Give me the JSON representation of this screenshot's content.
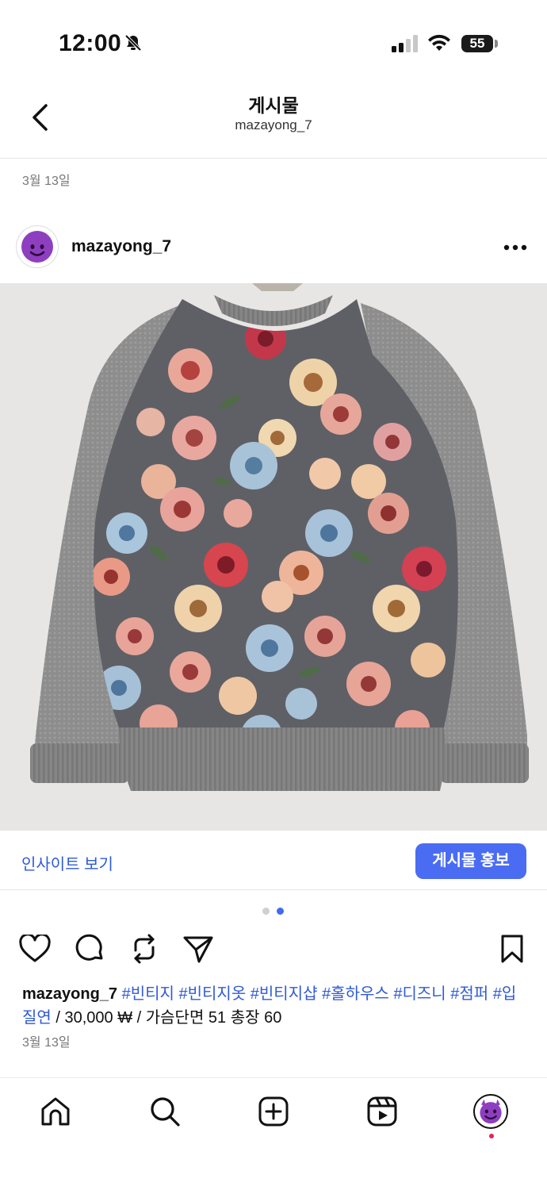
{
  "status_bar": {
    "time": "12:00",
    "battery": "55"
  },
  "header": {
    "title": "게시물",
    "subtitle": "mazayong_7"
  },
  "post": {
    "date_top": "3월 13일",
    "author": "mazayong_7",
    "insight_label": "인사이트 보기",
    "promote_label": "게시물 홍보",
    "caption_user": "mazayong_7",
    "caption_tags_1": "#빈티지 #빈티지옷 #빈티지샵 #홀하우스 #디즈니 #점퍼 #입질연",
    "caption_text": " / 30,000 ₩ / 가슴단면 51 총장 60",
    "date_bottom": "3월 13일",
    "carousel": {
      "count": 2,
      "active_index": 1
    }
  },
  "colors": {
    "link": "#2f5bd3",
    "promote": "#4a6cf2",
    "notification_dot": "#e0245e"
  },
  "icons": [
    "bell-slash-icon",
    "cellular-signal-icon",
    "wifi-icon",
    "battery-icon",
    "back-chevron-icon",
    "more-dots-icon",
    "heart-icon",
    "comment-icon",
    "repost-icon",
    "share-icon",
    "bookmark-icon",
    "home-icon",
    "search-icon",
    "create-icon",
    "reels-icon",
    "profile-avatar-icon"
  ]
}
